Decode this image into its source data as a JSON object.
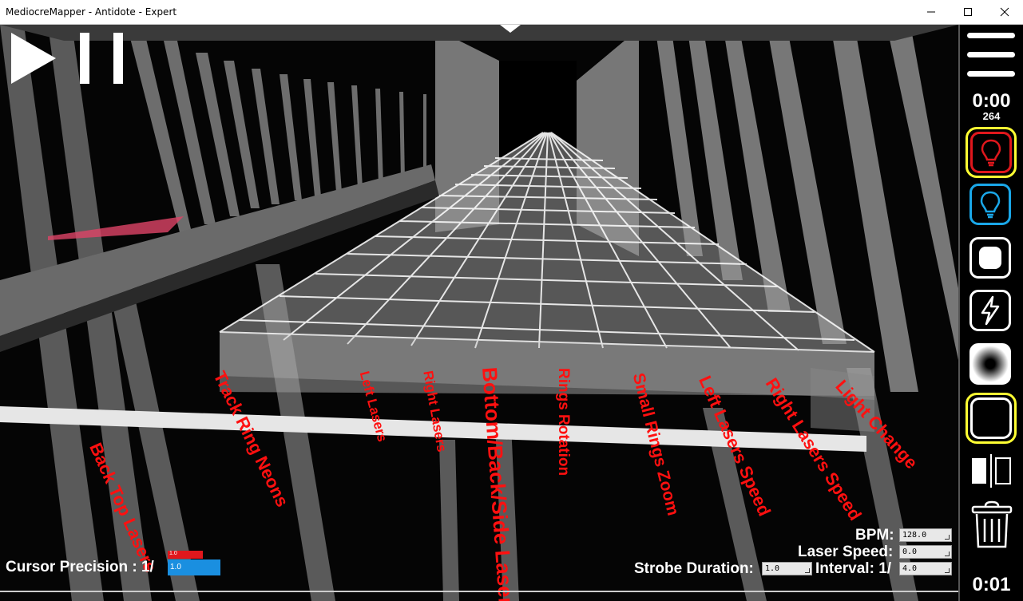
{
  "window": {
    "title": "MediocreMapper - Antidote - Expert"
  },
  "track_labels": [
    "Back Top Lasers",
    "Track Ring Neons",
    "Left Lasers",
    "Right Lasers",
    "Bottom/Back/Side Lasers",
    "Rings Rotation",
    "Small Rings Zoom",
    "Left Lasers Speed",
    "Right Lasers Speed",
    "Light Change"
  ],
  "sidebar": {
    "time": "0:00",
    "beat": "264",
    "bottom_time": "0:01"
  },
  "hud": {
    "cursor_precision_label": "Cursor Precision : 1/",
    "cursor_precision_top": "1.0",
    "cursor_precision_value": "1.0",
    "bpm_label": "BPM:",
    "bpm_value": "128.0",
    "laser_speed_label": "Laser Speed:",
    "laser_speed_value": "0.0",
    "strobe_label": "Strobe Duration:",
    "strobe_value": "1.0",
    "interval_label": "Interval: 1/",
    "interval_value": "4.0"
  },
  "colors": {
    "red_light": "#e0171c",
    "blue_light": "#1aa7e8",
    "highlight": "#ffff33",
    "label_red": "#ff1010"
  },
  "icons": [
    "play-icon",
    "pause-icon",
    "menu-icon",
    "red-light-icon",
    "blue-light-icon",
    "off-icon",
    "flash-icon",
    "fade-icon",
    "on-icon",
    "mirror-icon",
    "trash-icon"
  ]
}
